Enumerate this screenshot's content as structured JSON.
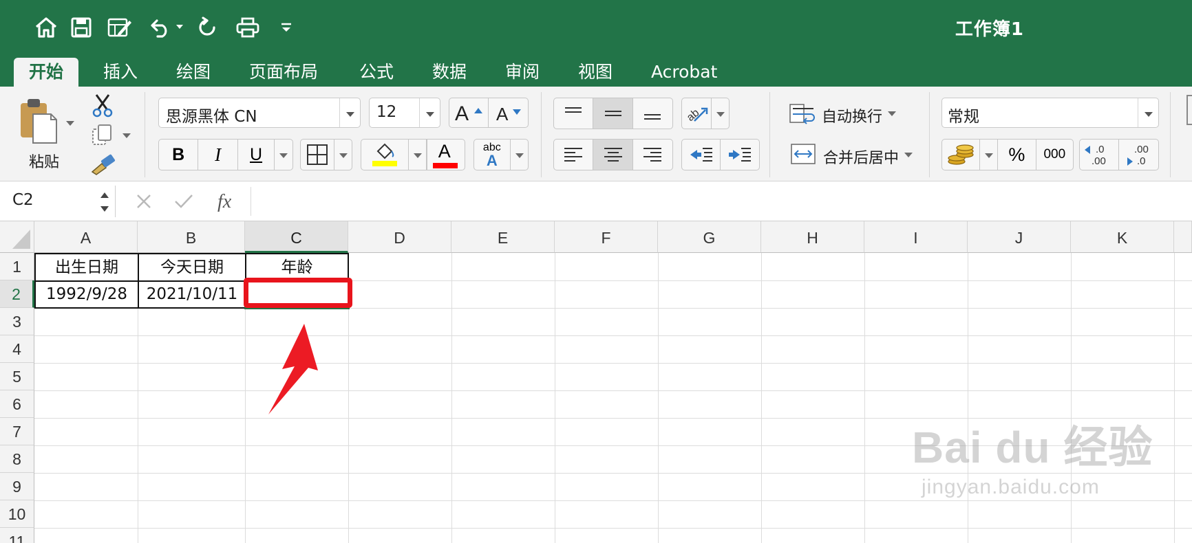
{
  "app": {
    "document_title": "工作簿1",
    "accent_color": "#227448",
    "quick_access": [
      "home-icon",
      "save-icon",
      "edit-icon",
      "undo-icon",
      "redo-icon",
      "print-icon",
      "customize-icon"
    ]
  },
  "tabs": [
    {
      "label": "开始",
      "active": true
    },
    {
      "label": "插入",
      "active": false
    },
    {
      "label": "绘图",
      "active": false
    },
    {
      "label": "页面布局",
      "active": false
    },
    {
      "label": "公式",
      "active": false
    },
    {
      "label": "数据",
      "active": false
    },
    {
      "label": "审阅",
      "active": false
    },
    {
      "label": "视图",
      "active": false
    },
    {
      "label": "Acrobat",
      "active": false
    }
  ],
  "ribbon": {
    "paste_label": "粘贴",
    "font_name": "思源黑体 CN",
    "font_size": "12",
    "bold": "B",
    "italic": "I",
    "underline": "U",
    "font_color_glyph": "A",
    "phonetic_top": "abc",
    "phonetic_bottom": "A",
    "wrap_text": "自动换行",
    "merge_center": "合并后居中",
    "number_format": "常规",
    "percent": "%",
    "comma": "000",
    "increase_decimal": ".0\n.00",
    "decrease_decimal": ".00\n.0",
    "highlight_color": "#ffff00",
    "font_color": "#ff0000"
  },
  "formula_bar": {
    "name_box": "C2",
    "formula": ""
  },
  "sheet": {
    "columns": [
      "A",
      "B",
      "C",
      "D",
      "E",
      "F",
      "G",
      "H",
      "I",
      "J",
      "K"
    ],
    "rows": [
      "1",
      "2",
      "3",
      "4",
      "5",
      "6",
      "7",
      "8",
      "9",
      "10",
      "11"
    ],
    "selected_cell": "C2",
    "cells": {
      "A1": "出生日期",
      "B1": "今天日期",
      "C1": "年龄",
      "A2": "1992/9/28",
      "B2": "2021/10/11",
      "C2": ""
    }
  },
  "annotation": {
    "highlight_color": "#e8141c"
  },
  "watermark": {
    "brand": "Bai du 经验",
    "url": "jingyan.baidu.com"
  }
}
